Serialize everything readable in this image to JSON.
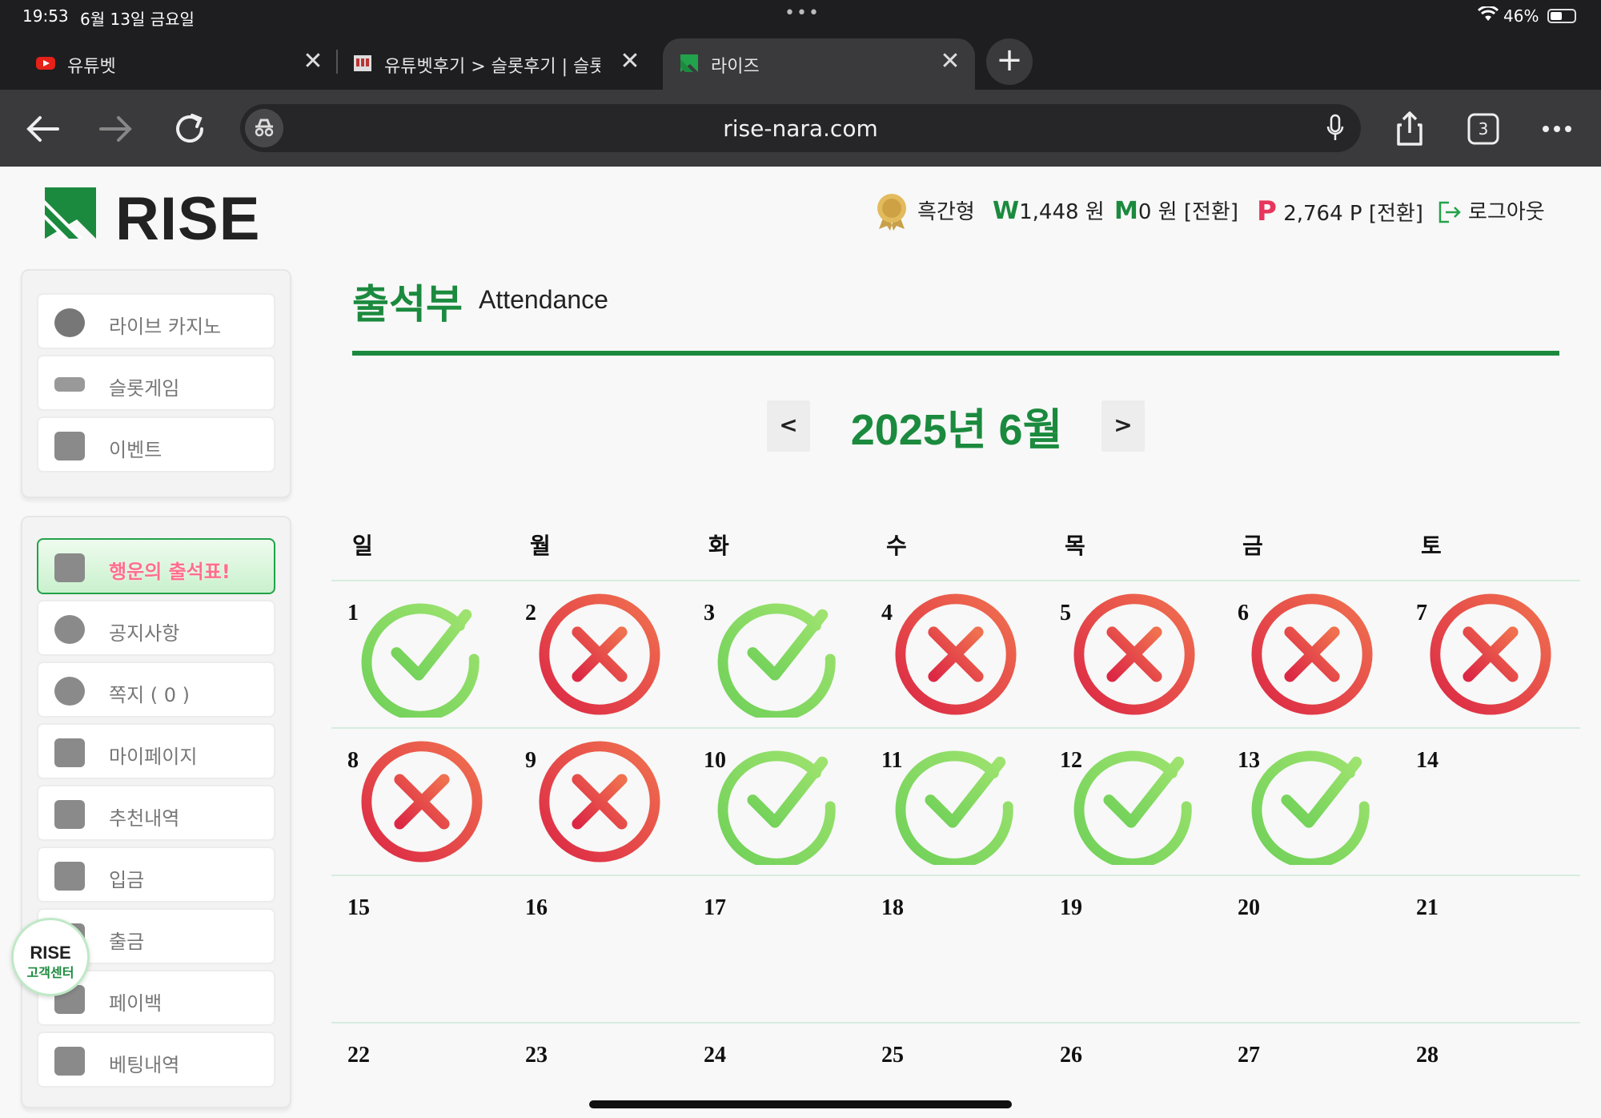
{
  "status": {
    "time": "19:53",
    "date": "6월 13일 금요일",
    "battery": "46%"
  },
  "tabs": [
    {
      "title": "유튜벳",
      "close": "✕",
      "active": false
    },
    {
      "title": "유튜벳후기 > 슬롯후기 | 슬롯",
      "close": "✕",
      "active": false
    },
    {
      "title": "라이즈",
      "close": "✕",
      "active": true
    }
  ],
  "toolbar": {
    "url": "rise-nara.com",
    "tab_count": "3",
    "new_tab": "+"
  },
  "site": {
    "logo_text": "RISE",
    "brand_color": "#1b8a3e"
  },
  "user": {
    "name": "흑간형",
    "won_symbol": "W",
    "won_value": "1,448 원",
    "m_symbol": "M",
    "m_value": "0 원 [전환]",
    "p_symbol": "P",
    "p_value": "2,764 P [전환]",
    "logout": "로그아웃"
  },
  "sidebar": {
    "top_items": [
      {
        "label": "라이브 카지노",
        "icon": "casino-chips-icon"
      },
      {
        "label": "슬롯게임",
        "icon": "slot-machine-icon"
      },
      {
        "label": "이벤트",
        "icon": "star-badge-icon"
      }
    ],
    "items": [
      {
        "label": "행운의 출석표!",
        "icon": "calendar-icon",
        "active": true
      },
      {
        "label": "공지사항",
        "icon": "info-icon"
      },
      {
        "label": "쪽지 ( 0 )",
        "icon": "chat-icon"
      },
      {
        "label": "마이페이지",
        "icon": "user-icon"
      },
      {
        "label": "추천내역",
        "icon": "heart-mail-icon"
      },
      {
        "label": "입금",
        "icon": "wallet-in-icon"
      },
      {
        "label": "출금",
        "icon": "wallet-out-icon"
      },
      {
        "label": "페이백",
        "icon": "coins-icon"
      },
      {
        "label": "베팅내역",
        "icon": "list-icon"
      }
    ],
    "cs_badge": {
      "line1": "RISE",
      "line2": "고객센터"
    }
  },
  "attendance": {
    "title": "출석부",
    "subtitle": "Attendance",
    "month_label": "2025년 6월",
    "prev": "<",
    "next": ">",
    "weekdays": [
      "일",
      "월",
      "화",
      "수",
      "목",
      "금",
      "토"
    ],
    "weeks": [
      [
        {
          "day": "1",
          "status": "check"
        },
        {
          "day": "2",
          "status": "x"
        },
        {
          "day": "3",
          "status": "check"
        },
        {
          "day": "4",
          "status": "x"
        },
        {
          "day": "5",
          "status": "x"
        },
        {
          "day": "6",
          "status": "x"
        },
        {
          "day": "7",
          "status": "x"
        }
      ],
      [
        {
          "day": "8",
          "status": "x"
        },
        {
          "day": "9",
          "status": "x"
        },
        {
          "day": "10",
          "status": "check"
        },
        {
          "day": "11",
          "status": "check"
        },
        {
          "day": "12",
          "status": "check"
        },
        {
          "day": "13",
          "status": "check"
        },
        {
          "day": "14",
          "status": "none"
        }
      ],
      [
        {
          "day": "15",
          "status": "none"
        },
        {
          "day": "16",
          "status": "none"
        },
        {
          "day": "17",
          "status": "none"
        },
        {
          "day": "18",
          "status": "none"
        },
        {
          "day": "19",
          "status": "none"
        },
        {
          "day": "20",
          "status": "none"
        },
        {
          "day": "21",
          "status": "none"
        }
      ],
      [
        {
          "day": "22",
          "status": "none"
        },
        {
          "day": "23",
          "status": "none"
        },
        {
          "day": "24",
          "status": "none"
        },
        {
          "day": "25",
          "status": "none"
        },
        {
          "day": "26",
          "status": "none"
        },
        {
          "day": "27",
          "status": "none"
        },
        {
          "day": "28",
          "status": "none"
        }
      ]
    ]
  }
}
